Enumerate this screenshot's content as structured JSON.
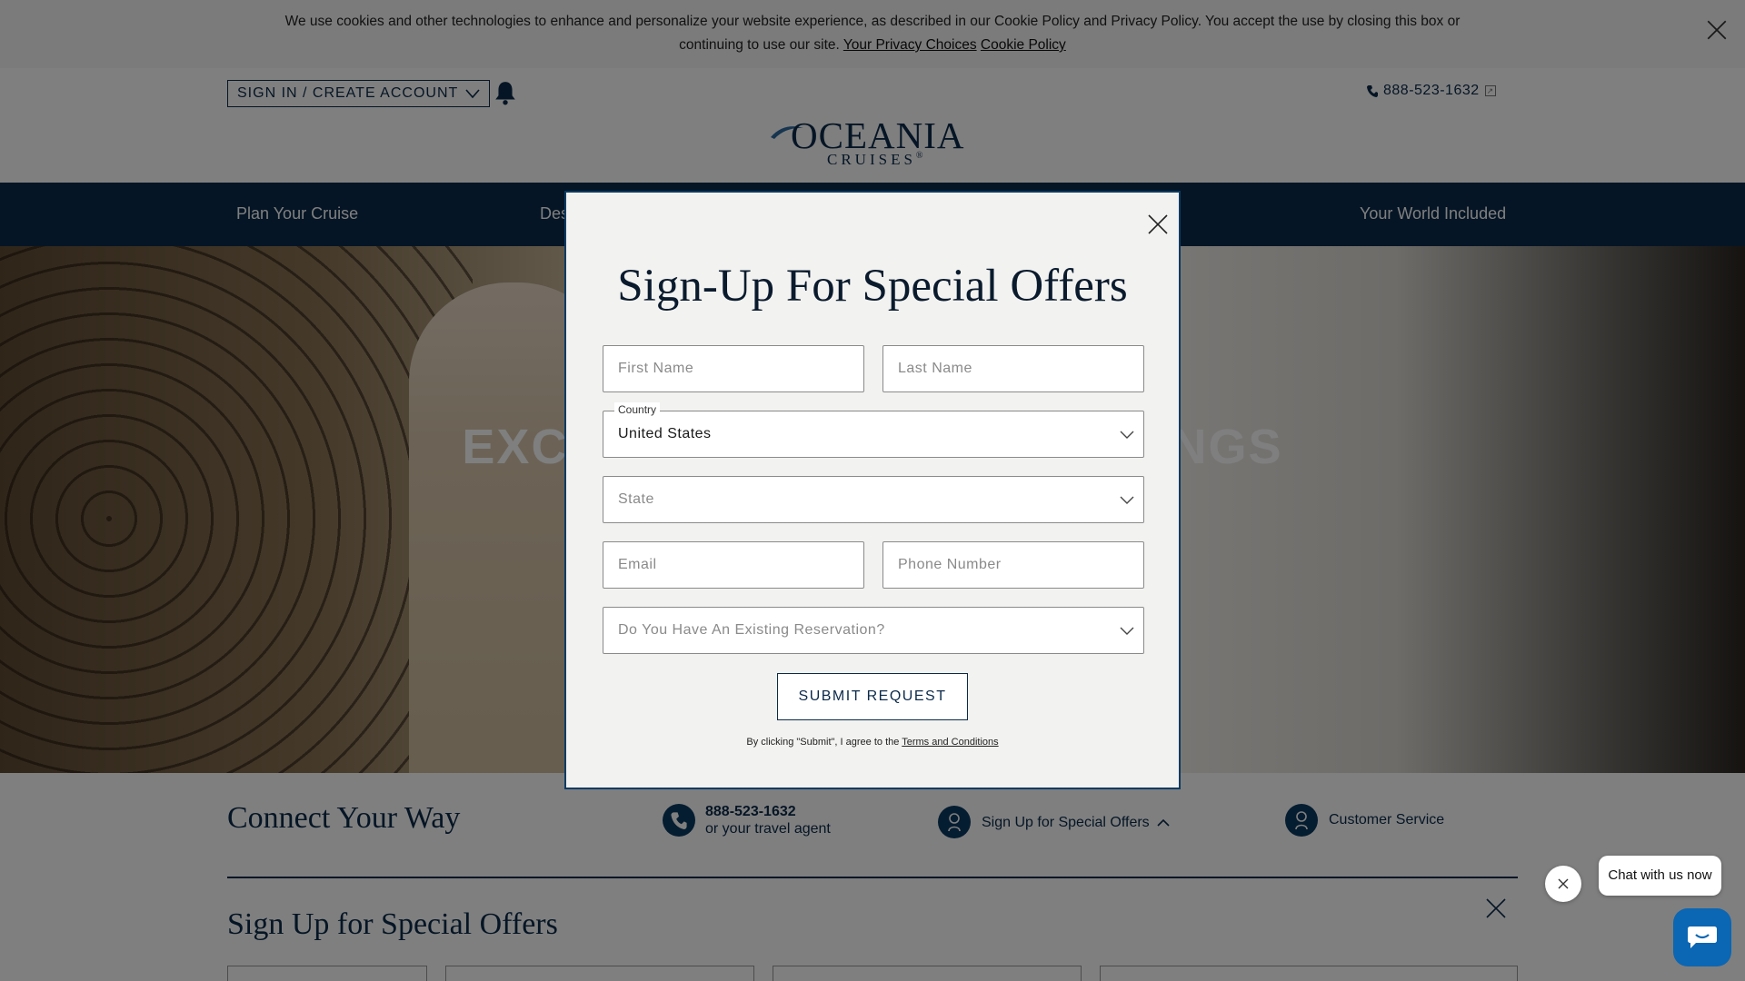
{
  "cookie_banner": {
    "line1": "We use cookies and other technologies to enhance and personalize your website experience, as described in our Cookie Policy and Privacy Policy. You accept the use by closing this box or",
    "line2_prefix": "continuing to use our site.",
    "privacy_choices_link": "Your Privacy Choices",
    "cookie_policy_link": "Cookie Policy",
    "close_icon": "close-icon"
  },
  "header": {
    "signin_label": "SIGN IN / CREATE ACCOUNT",
    "bell_icon": "bell-icon",
    "phone": "888-523-1632",
    "logo_main": "OCEANIA",
    "logo_sub": "CRUISES",
    "logo_mark": "®"
  },
  "nav": {
    "items": [
      "Plan Your Cruise",
      "Des",
      "Your World Included"
    ]
  },
  "hero": {
    "title": "EXCL                                    INGS"
  },
  "connect": {
    "title": "Connect Your Way",
    "phone_number": "888-523-1632",
    "phone_sub": "or your travel agent",
    "offers_label": "Sign Up for Special Offers",
    "service_label": "Customer Service",
    "signup_title": "Sign Up for Special Offers"
  },
  "modal": {
    "title": "Sign-Up For Special Offers",
    "first_name_placeholder": "First Name",
    "last_name_placeholder": "Last Name",
    "country_label": "Country",
    "country_value": "United States",
    "state_placeholder": "State",
    "email_placeholder": "Email",
    "phone_placeholder": "Phone Number",
    "reservation_placeholder": "Do You Have An Existing Reservation?",
    "submit_label": "SUBMIT REQUEST",
    "terms_prefix": "By clicking \"Submit\", I agree to the",
    "terms_link": "Terms and Conditions"
  },
  "chat": {
    "bubble_text": "Chat with us now"
  },
  "colors": {
    "brand_navy": "#0b2a4a",
    "chat_blue": "#0b66b3",
    "overlay": "rgba(0,0,0,0.5)"
  }
}
